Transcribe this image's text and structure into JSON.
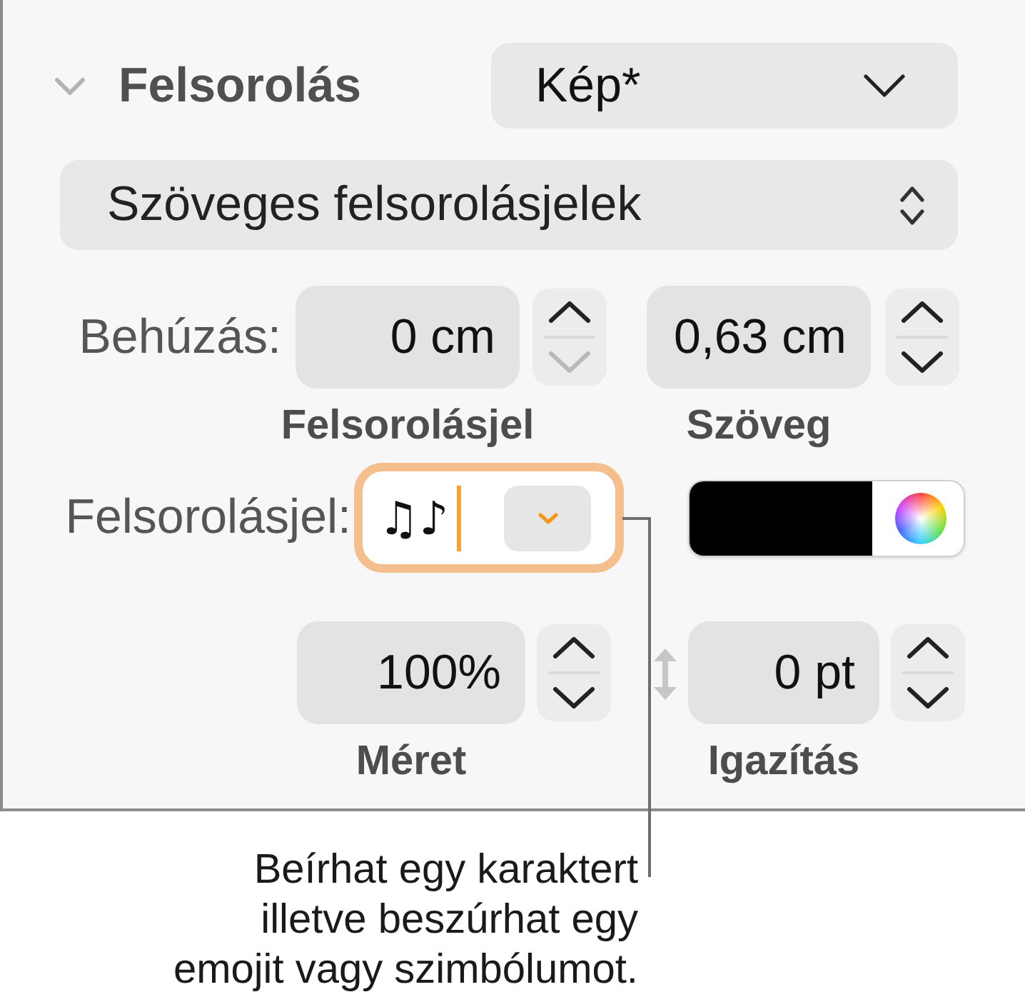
{
  "section": {
    "title": "Felsorolás",
    "expanded": true
  },
  "style_dropdown": {
    "value": "Kép*"
  },
  "bullet_type_popup": {
    "value": "Szöveges felsorolásjelek"
  },
  "indent": {
    "label": "Behúzás:",
    "fields": [
      {
        "value": "0 cm",
        "caption": "Felsorolásjel",
        "increment_disabled": false,
        "decrement_disabled": true
      },
      {
        "value": "0,63 cm",
        "caption": "Szöveg",
        "increment_disabled": false,
        "decrement_disabled": false
      }
    ]
  },
  "bullet": {
    "label": "Felsorolásjel:",
    "value": "♫♪",
    "focused": true,
    "color": "#000000"
  },
  "size_alignment": {
    "fields": [
      {
        "value": "100%",
        "caption": "Méret",
        "increment_disabled": false,
        "decrement_disabled": false
      },
      {
        "value": "0 pt",
        "caption": "Igazítás",
        "increment_disabled": false,
        "decrement_disabled": false
      }
    ]
  },
  "callout": {
    "lines": [
      "Beírhat egy karaktert",
      "illetve beszúrhat egy",
      "emojit vagy szimbólumot."
    ]
  }
}
